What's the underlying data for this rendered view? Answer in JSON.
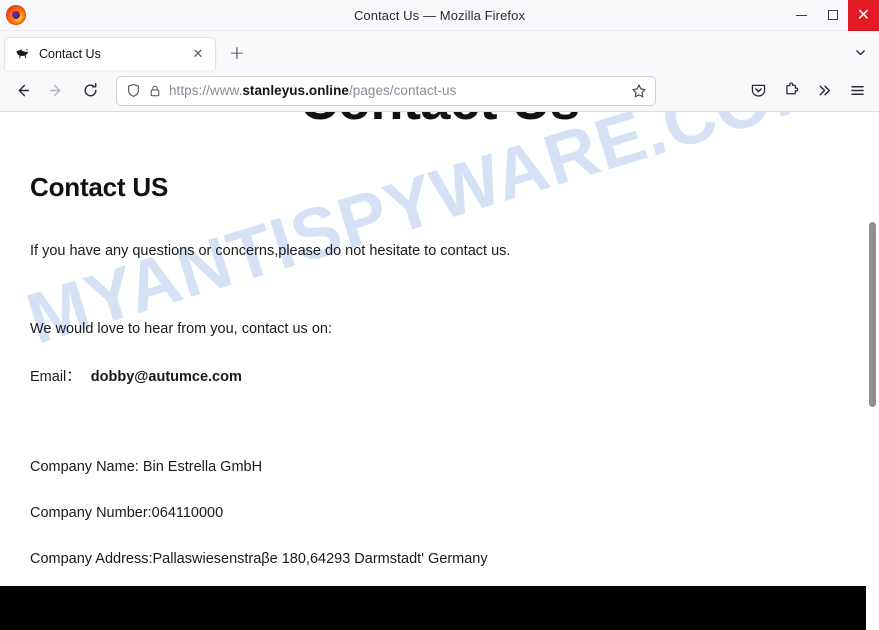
{
  "window": {
    "title": "Contact Us — Mozilla Firefox",
    "app_icon": "firefox-logo",
    "controls": {
      "minimize": "–",
      "maximize": "□",
      "close": "✕",
      "close_color": "#e01b24"
    }
  },
  "tabstrip": {
    "tabs": [
      {
        "title": "Contact Us",
        "favicon": "bull-silhouette-favicon",
        "close_label": "✕",
        "active": true
      }
    ],
    "new_tab_label": "+",
    "all_tabs_icon": "chevron-down-icon"
  },
  "navbar": {
    "back_icon": "←",
    "forward_icon": "→",
    "reload_icon": "⟳",
    "shield_icon": "shield-icon",
    "lock_icon": "lock-icon",
    "bookmark_icon": "star-icon",
    "url": {
      "scheme": "https://www.",
      "host": "stanleyus.online",
      "path": "/pages/contact-us",
      "full": "https://www.stanleyus.online/pages/contact-us"
    },
    "right_icons": [
      {
        "name": "pocket-icon",
        "glyph": "pocket"
      },
      {
        "name": "extensions-icon",
        "glyph": "puzzle"
      },
      {
        "name": "overflow-menu-icon",
        "glyph": "»"
      },
      {
        "name": "app-menu-icon",
        "glyph": "≡"
      }
    ]
  },
  "page": {
    "banner_heading": "Contact Us",
    "watermark": "MYANTISPYWARE.COM",
    "watermark_color": "#c5d6f2",
    "heading": "Contact US",
    "intro": "If you have any questions or concerns,please do not hesitate to contact us.",
    "love_line": "We would love to hear from you, contact us on:",
    "email_label": "Email：",
    "email_value": "dobby@autumce.com",
    "company_name": "Company Name: Bin Estrella GmbH",
    "company_number": "Company Number:064110000",
    "company_address": "Company Address:Pallaswiesenstraβe 180,64293 Darmstadt' Germany",
    "footer_color": "#000000"
  }
}
